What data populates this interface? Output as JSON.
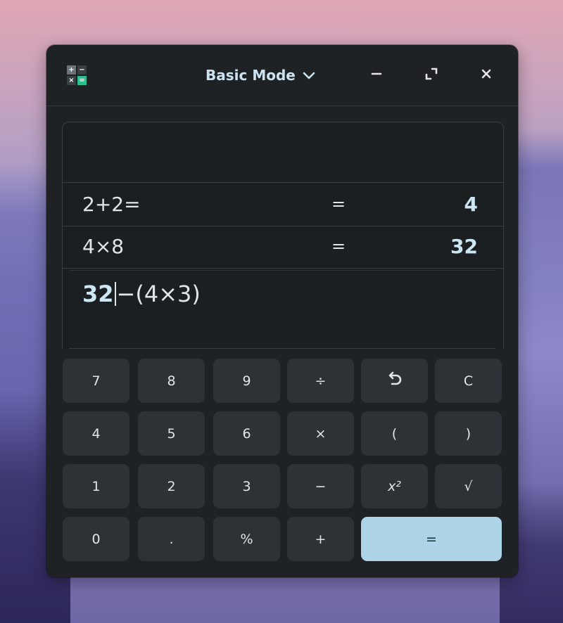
{
  "window": {
    "mode_label": "Basic Mode",
    "controls": {
      "minimize": "–",
      "maximize": "⤢",
      "close": "✕"
    },
    "icon_glyphs": [
      "+",
      "−",
      "×",
      "="
    ]
  },
  "history": [
    {
      "expression": "2+2=",
      "equals": "=",
      "result": "4"
    },
    {
      "expression": "4×8",
      "equals": "=",
      "result": "32"
    }
  ],
  "input": {
    "bold_part": "32",
    "rest": "−(4×3)"
  },
  "keypad": {
    "rows": [
      [
        "7",
        "8",
        "9",
        "÷",
        "↶",
        "C"
      ],
      [
        "4",
        "5",
        "6",
        "×",
        "(",
        ")"
      ],
      [
        "1",
        "2",
        "3",
        "−",
        "x²",
        "√"
      ],
      [
        "0",
        ".",
        "%",
        "+",
        "="
      ]
    ]
  },
  "colors": {
    "accent": "#acd4e6",
    "window_bg": "#1f2225",
    "key_bg": "#2e3236"
  }
}
